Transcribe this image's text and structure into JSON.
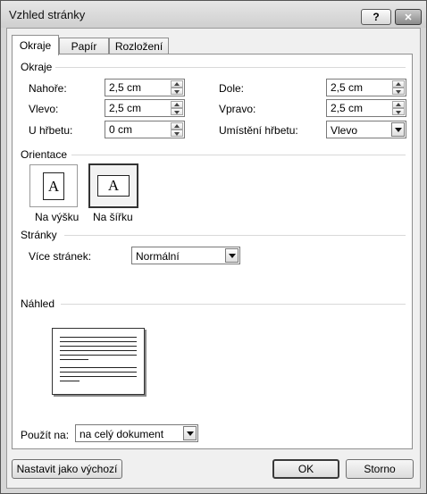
{
  "window": {
    "title": "Vzhled stránky",
    "help_glyph": "?",
    "close_glyph": "✕"
  },
  "tabs": [
    {
      "label": "Okraje",
      "active": true
    },
    {
      "label": "Papír",
      "active": false
    },
    {
      "label": "Rozložení",
      "active": false
    }
  ],
  "margins": {
    "section_label": "Okraje",
    "top": {
      "label": "Nahoře:",
      "value": "2,5 cm"
    },
    "bottom": {
      "label": "Dole:",
      "value": "2,5 cm"
    },
    "left": {
      "label": "Vlevo:",
      "value": "2,5 cm"
    },
    "right": {
      "label": "Vpravo:",
      "value": "2,5 cm"
    },
    "gutter": {
      "label": "U hřbetu:",
      "value": "0 cm"
    },
    "gutter_position": {
      "label": "Umístění hřbetu:",
      "value": "Vlevo"
    }
  },
  "orientation": {
    "section_label": "Orientace",
    "portrait": {
      "label": "Na výšku",
      "glyph": "A",
      "selected": false
    },
    "landscape": {
      "label": "Na šířku",
      "glyph": "A",
      "selected": true
    }
  },
  "pages": {
    "section_label": "Stránky",
    "multiple_label": "Více stránek:",
    "multiple_value": "Normální"
  },
  "preview": {
    "section_label": "Náhled"
  },
  "apply_to": {
    "label": "Použít na:",
    "value": "na celý dokument"
  },
  "footer": {
    "default_button": "Nastavit jako výchozí",
    "ok": "OK",
    "cancel": "Storno"
  }
}
